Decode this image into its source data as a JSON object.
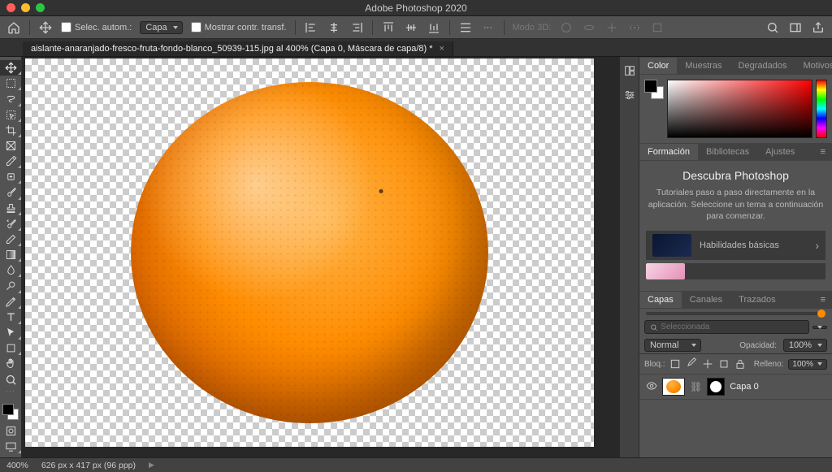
{
  "titlebar": {
    "app_title": "Adobe Photoshop 2020"
  },
  "options": {
    "auto_select": "Selec. autom.:",
    "layer_target": "Capa",
    "show_transform": "Mostrar contr. transf.",
    "mode_3d": "Modo 3D:"
  },
  "tabs": {
    "doc": "aislante-anaranjado-fresco-fruta-fondo-blanco_50939-115.jpg al 400% (Capa 0, Máscara de capa/8) *"
  },
  "color_panel": {
    "color": "Color",
    "muestras": "Muestras",
    "degradados": "Degradados",
    "motivos": "Motivos"
  },
  "learn_panel": {
    "formacion": "Formación",
    "bibliotecas": "Bibliotecas",
    "ajustes": "Ajustes",
    "headline": "Descubra Photoshop",
    "body": "Tutoriales paso a paso directamente en la aplicación. Seleccione un tema a continuación para comenzar.",
    "card1": "Habilidades básicas"
  },
  "layers_panel": {
    "capas": "Capas",
    "canales": "Canales",
    "trazados": "Trazados",
    "filter_placeholder": "Seleccionada",
    "blend": "Normal",
    "opacity_label": "Opacidad:",
    "opacity_value": "100%",
    "lock_label": "Bloq.:",
    "fill_label": "Relleno:",
    "fill_value": "100%",
    "layer_name": "Capa 0"
  },
  "status": {
    "zoom": "400%",
    "dims": "626 px x 417 px (96 ppp)"
  }
}
